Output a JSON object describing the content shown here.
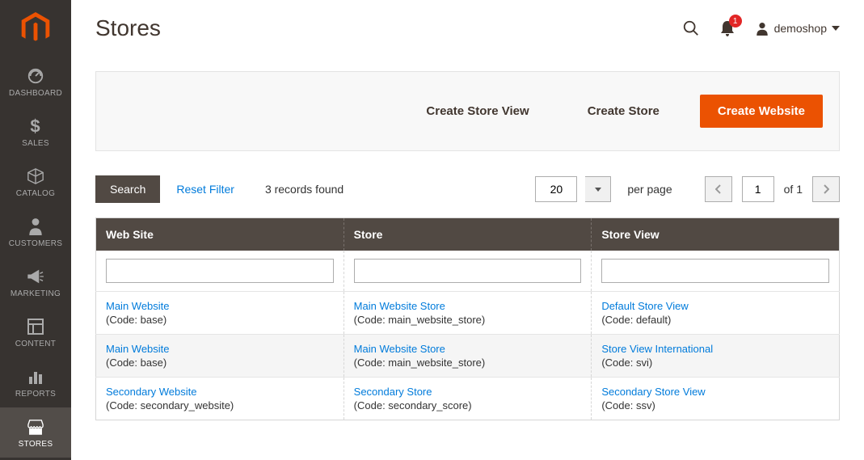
{
  "sidebar": {
    "items": [
      {
        "label": "DASHBOARD",
        "icon": "dashboard"
      },
      {
        "label": "SALES",
        "icon": "dollar"
      },
      {
        "label": "CATALOG",
        "icon": "box"
      },
      {
        "label": "CUSTOMERS",
        "icon": "person"
      },
      {
        "label": "MARKETING",
        "icon": "megaphone"
      },
      {
        "label": "CONTENT",
        "icon": "layout"
      },
      {
        "label": "REPORTS",
        "icon": "bars"
      },
      {
        "label": "STORES",
        "icon": "storefront",
        "active": true
      }
    ]
  },
  "header": {
    "title": "Stores",
    "notifications": "1",
    "username": "demoshop"
  },
  "actions": {
    "create_store_view": "Create Store View",
    "create_store": "Create Store",
    "create_website": "Create Website"
  },
  "controls": {
    "search": "Search",
    "reset_filter": "Reset Filter",
    "records_found": "3 records found",
    "page_size": "20",
    "per_page": "per page",
    "current_page": "1",
    "of_label": "of 1"
  },
  "table": {
    "headers": {
      "website": "Web Site",
      "store": "Store",
      "store_view": "Store View"
    },
    "rows": [
      {
        "website_name": "Main Website",
        "website_code": "(Code: base)",
        "store_name": "Main Website Store",
        "store_code": "(Code: main_website_store)",
        "view_name": "Default Store View",
        "view_code": "(Code: default)"
      },
      {
        "website_name": "Main Website",
        "website_code": "(Code: base)",
        "store_name": "Main Website Store",
        "store_code": "(Code: main_website_store)",
        "view_name": "Store View International",
        "view_code": "(Code: svi)"
      },
      {
        "website_name": "Secondary Website",
        "website_code": "(Code: secondary_website)",
        "store_name": "Secondary Store",
        "store_code": "(Code: secondary_score)",
        "view_name": "Secondary Store View",
        "view_code": "(Code: ssv)"
      }
    ]
  }
}
